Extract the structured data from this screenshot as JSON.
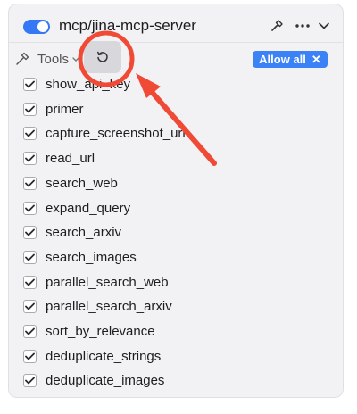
{
  "server": {
    "enabled": true,
    "name": "mcp/jina-mcp-server",
    "icons": {
      "hammer": "hammer-icon",
      "more": "ellipsis-icon",
      "chevron": "chevron-down-icon"
    }
  },
  "tools_section": {
    "label": "Tools",
    "refresh_icon": "refresh-icon",
    "allow_all_label": "Allow all",
    "allow_all_close": "✕"
  },
  "tools": [
    {
      "label": "show_api_key",
      "checked": true
    },
    {
      "label": "primer",
      "checked": true
    },
    {
      "label": "capture_screenshot_url",
      "checked": true
    },
    {
      "label": "read_url",
      "checked": true
    },
    {
      "label": "search_web",
      "checked": true
    },
    {
      "label": "expand_query",
      "checked": true
    },
    {
      "label": "search_arxiv",
      "checked": true
    },
    {
      "label": "search_images",
      "checked": true
    },
    {
      "label": "parallel_search_web",
      "checked": true
    },
    {
      "label": "parallel_search_arxiv",
      "checked": true
    },
    {
      "label": "sort_by_relevance",
      "checked": true
    },
    {
      "label": "deduplicate_strings",
      "checked": true
    },
    {
      "label": "deduplicate_images",
      "checked": true
    }
  ],
  "colors": {
    "accent": "#3478f6",
    "annotation": "#f04a36"
  }
}
